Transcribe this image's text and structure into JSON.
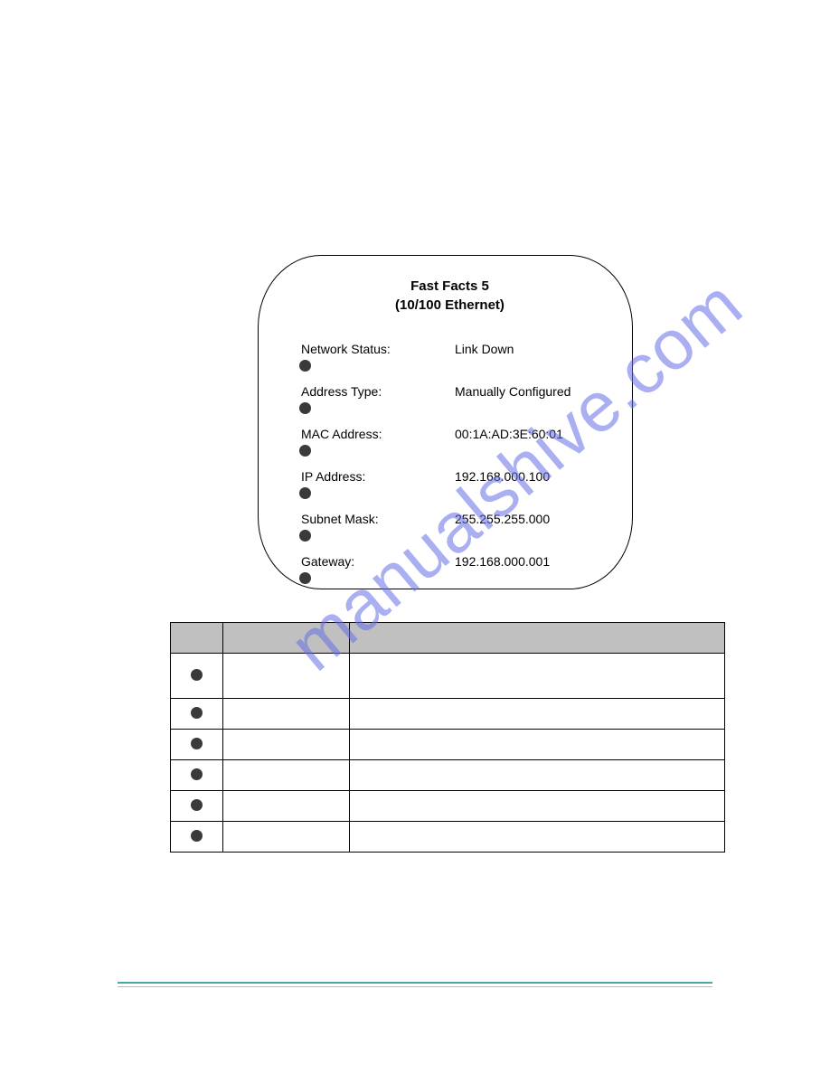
{
  "watermark": "manualshive.com",
  "screen": {
    "title_line1": "Fast Facts 5",
    "title_line2": "(10/100 Ethernet)",
    "rows": [
      {
        "label": "Network Status:",
        "value": "Link Down"
      },
      {
        "label": "Address Type:",
        "value": "Manually Configured"
      },
      {
        "label": "MAC Address:",
        "value": "00:1A:AD:3E:60:01"
      },
      {
        "label": "IP Address:",
        "value": "192.168.000.100"
      },
      {
        "label": "Subnet Mask:",
        "value": "255.255.255.000"
      },
      {
        "label": "Gateway:",
        "value": "192.168.000.001"
      }
    ]
  },
  "table": {
    "headers": [
      "",
      "",
      ""
    ],
    "rows": [
      {
        "c1_dot": true,
        "c2": "",
        "c3": ""
      },
      {
        "c1_dot": true,
        "c2": "",
        "c3": ""
      },
      {
        "c1_dot": true,
        "c2": "",
        "c3": ""
      },
      {
        "c1_dot": true,
        "c2": "",
        "c3": ""
      },
      {
        "c1_dot": true,
        "c2": "",
        "c3": ""
      },
      {
        "c1_dot": true,
        "c2": "",
        "c3": ""
      }
    ]
  }
}
